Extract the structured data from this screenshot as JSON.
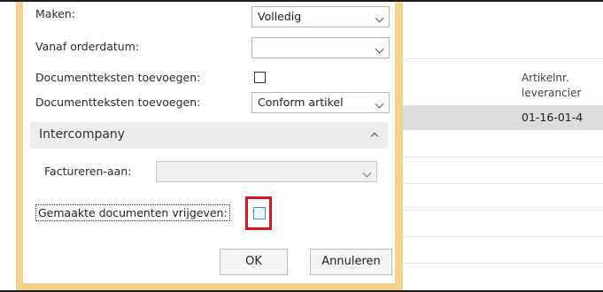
{
  "dialog": {
    "rows": {
      "maken_label": "Maken:",
      "maken_value": "Volledig",
      "vanaf_label": "Vanaf orderdatum:",
      "vanaf_value": "",
      "doc_check_label": "Documentteksten toevoegen:",
      "doc_select_label": "Documentteksten toevoegen:",
      "doc_select_value": "Conform artikel"
    },
    "section": {
      "title": "Intercompany",
      "factureren_label": "Factureren-aan:",
      "factureren_value": ""
    },
    "release_label": "Gemaakte documenten vrijgeven:",
    "buttons": {
      "ok": "OK",
      "cancel": "Annuleren"
    }
  },
  "background_list": {
    "column_header": "Artikelnr.\nleverancier",
    "selected_cell": "01-16-01-4"
  },
  "colors": {
    "dialog_border": "#f3d28e",
    "highlight": "#d8121e",
    "section_bar": "#ececec",
    "selected_row": "#dcdcdc"
  }
}
